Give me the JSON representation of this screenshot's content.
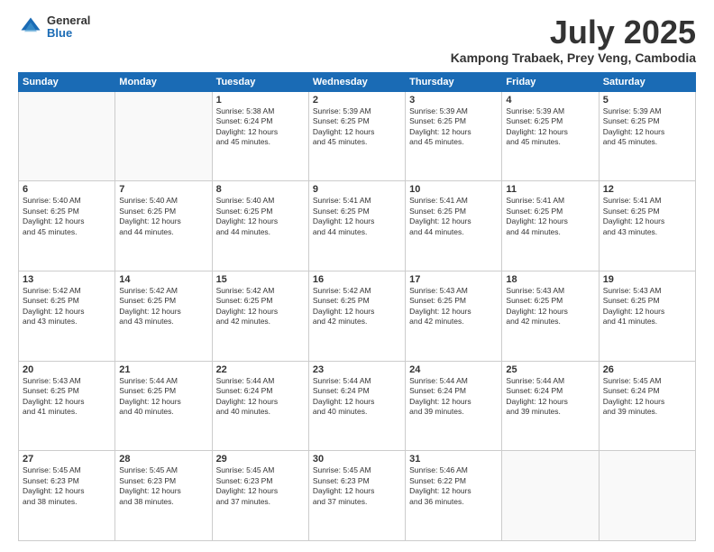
{
  "logo": {
    "general": "General",
    "blue": "Blue"
  },
  "title": "July 2025",
  "location": "Kampong Trabaek, Prey Veng, Cambodia",
  "weekdays": [
    "Sunday",
    "Monday",
    "Tuesday",
    "Wednesday",
    "Thursday",
    "Friday",
    "Saturday"
  ],
  "weeks": [
    [
      {
        "day": "",
        "info": ""
      },
      {
        "day": "",
        "info": ""
      },
      {
        "day": "1",
        "info": "Sunrise: 5:38 AM\nSunset: 6:24 PM\nDaylight: 12 hours\nand 45 minutes."
      },
      {
        "day": "2",
        "info": "Sunrise: 5:39 AM\nSunset: 6:25 PM\nDaylight: 12 hours\nand 45 minutes."
      },
      {
        "day": "3",
        "info": "Sunrise: 5:39 AM\nSunset: 6:25 PM\nDaylight: 12 hours\nand 45 minutes."
      },
      {
        "day": "4",
        "info": "Sunrise: 5:39 AM\nSunset: 6:25 PM\nDaylight: 12 hours\nand 45 minutes."
      },
      {
        "day": "5",
        "info": "Sunrise: 5:39 AM\nSunset: 6:25 PM\nDaylight: 12 hours\nand 45 minutes."
      }
    ],
    [
      {
        "day": "6",
        "info": "Sunrise: 5:40 AM\nSunset: 6:25 PM\nDaylight: 12 hours\nand 45 minutes."
      },
      {
        "day": "7",
        "info": "Sunrise: 5:40 AM\nSunset: 6:25 PM\nDaylight: 12 hours\nand 44 minutes."
      },
      {
        "day": "8",
        "info": "Sunrise: 5:40 AM\nSunset: 6:25 PM\nDaylight: 12 hours\nand 44 minutes."
      },
      {
        "day": "9",
        "info": "Sunrise: 5:41 AM\nSunset: 6:25 PM\nDaylight: 12 hours\nand 44 minutes."
      },
      {
        "day": "10",
        "info": "Sunrise: 5:41 AM\nSunset: 6:25 PM\nDaylight: 12 hours\nand 44 minutes."
      },
      {
        "day": "11",
        "info": "Sunrise: 5:41 AM\nSunset: 6:25 PM\nDaylight: 12 hours\nand 44 minutes."
      },
      {
        "day": "12",
        "info": "Sunrise: 5:41 AM\nSunset: 6:25 PM\nDaylight: 12 hours\nand 43 minutes."
      }
    ],
    [
      {
        "day": "13",
        "info": "Sunrise: 5:42 AM\nSunset: 6:25 PM\nDaylight: 12 hours\nand 43 minutes."
      },
      {
        "day": "14",
        "info": "Sunrise: 5:42 AM\nSunset: 6:25 PM\nDaylight: 12 hours\nand 43 minutes."
      },
      {
        "day": "15",
        "info": "Sunrise: 5:42 AM\nSunset: 6:25 PM\nDaylight: 12 hours\nand 42 minutes."
      },
      {
        "day": "16",
        "info": "Sunrise: 5:42 AM\nSunset: 6:25 PM\nDaylight: 12 hours\nand 42 minutes."
      },
      {
        "day": "17",
        "info": "Sunrise: 5:43 AM\nSunset: 6:25 PM\nDaylight: 12 hours\nand 42 minutes."
      },
      {
        "day": "18",
        "info": "Sunrise: 5:43 AM\nSunset: 6:25 PM\nDaylight: 12 hours\nand 42 minutes."
      },
      {
        "day": "19",
        "info": "Sunrise: 5:43 AM\nSunset: 6:25 PM\nDaylight: 12 hours\nand 41 minutes."
      }
    ],
    [
      {
        "day": "20",
        "info": "Sunrise: 5:43 AM\nSunset: 6:25 PM\nDaylight: 12 hours\nand 41 minutes."
      },
      {
        "day": "21",
        "info": "Sunrise: 5:44 AM\nSunset: 6:25 PM\nDaylight: 12 hours\nand 40 minutes."
      },
      {
        "day": "22",
        "info": "Sunrise: 5:44 AM\nSunset: 6:24 PM\nDaylight: 12 hours\nand 40 minutes."
      },
      {
        "day": "23",
        "info": "Sunrise: 5:44 AM\nSunset: 6:24 PM\nDaylight: 12 hours\nand 40 minutes."
      },
      {
        "day": "24",
        "info": "Sunrise: 5:44 AM\nSunset: 6:24 PM\nDaylight: 12 hours\nand 39 minutes."
      },
      {
        "day": "25",
        "info": "Sunrise: 5:44 AM\nSunset: 6:24 PM\nDaylight: 12 hours\nand 39 minutes."
      },
      {
        "day": "26",
        "info": "Sunrise: 5:45 AM\nSunset: 6:24 PM\nDaylight: 12 hours\nand 39 minutes."
      }
    ],
    [
      {
        "day": "27",
        "info": "Sunrise: 5:45 AM\nSunset: 6:23 PM\nDaylight: 12 hours\nand 38 minutes."
      },
      {
        "day": "28",
        "info": "Sunrise: 5:45 AM\nSunset: 6:23 PM\nDaylight: 12 hours\nand 38 minutes."
      },
      {
        "day": "29",
        "info": "Sunrise: 5:45 AM\nSunset: 6:23 PM\nDaylight: 12 hours\nand 37 minutes."
      },
      {
        "day": "30",
        "info": "Sunrise: 5:45 AM\nSunset: 6:23 PM\nDaylight: 12 hours\nand 37 minutes."
      },
      {
        "day": "31",
        "info": "Sunrise: 5:46 AM\nSunset: 6:22 PM\nDaylight: 12 hours\nand 36 minutes."
      },
      {
        "day": "",
        "info": ""
      },
      {
        "day": "",
        "info": ""
      }
    ]
  ]
}
